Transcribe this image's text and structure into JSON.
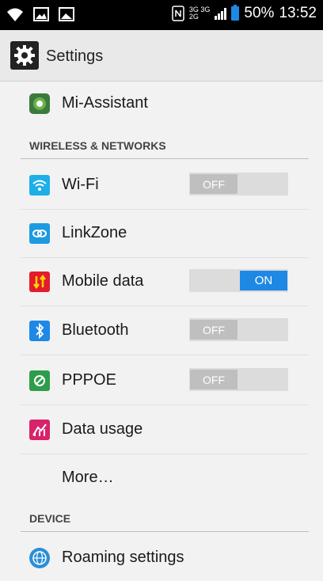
{
  "status_bar": {
    "net_top": "3G 3G",
    "net_bottom": "2G",
    "battery": "50%",
    "time": "13:52"
  },
  "action_bar": {
    "title": "Settings"
  },
  "items": {
    "mi_assistant": "Mi-Assistant",
    "section_wireless": "WIRELESS & NETWORKS",
    "wifi": "Wi-Fi",
    "wifi_toggle": "OFF",
    "linkzone": "LinkZone",
    "mobile_data": "Mobile data",
    "mobile_data_toggle": "ON",
    "bluetooth": "Bluetooth",
    "bluetooth_toggle": "OFF",
    "pppoe": "PPPOE",
    "pppoe_toggle": "OFF",
    "data_usage": "Data usage",
    "more": "More…",
    "section_device": "DEVICE",
    "roaming": "Roaming settings"
  },
  "colors": {
    "accent": "#1e88e5",
    "wifi_icon": "#1eaee8",
    "mobile_data_icon": "#e31b2d",
    "pppoe_icon": "#2e9d4b",
    "data_usage_icon": "#d8236a"
  }
}
